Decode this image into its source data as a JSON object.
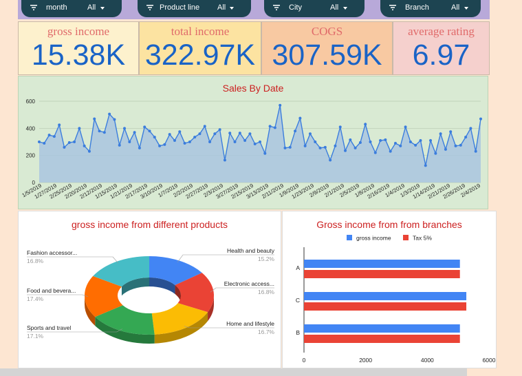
{
  "filters": [
    {
      "name": "month",
      "value": "All"
    },
    {
      "name": "Product line",
      "value": "All"
    },
    {
      "name": "City",
      "value": "All"
    },
    {
      "name": "Branch",
      "value": "All"
    }
  ],
  "kpis": [
    {
      "label": "gross income",
      "value": "15.38K"
    },
    {
      "label": "total income",
      "value": "322.97K"
    },
    {
      "label": "COGS",
      "value": "307.59K"
    },
    {
      "label": "average rating",
      "value": "6.97"
    }
  ],
  "colors": {
    "filter_bar": "#b8a9d9",
    "filter_pill": "#1d4451",
    "background": "#fde6d2",
    "kpi_bgs": [
      "#fdf1cd",
      "#fce3a1",
      "#f8c9a2",
      "#f5d0cd"
    ],
    "value_text": "#1a63c6",
    "title_text": "#cc1f1f",
    "line": "#3b7ddd",
    "area": "#a9c6df",
    "panel_green": "#d9ead3",
    "gross_bar": "#4285f4",
    "tax_bar": "#ea4335"
  },
  "sales_chart": {
    "title": "Sales By Date",
    "chart_data": {
      "type": "area",
      "title": "Sales By Date",
      "ylim": [
        0,
        600
      ],
      "y_ticks": [
        0,
        200,
        400,
        600
      ],
      "grid": true,
      "x_labels": [
        "1/5/2019",
        "1/27/2019",
        "2/25/2019",
        "2/20/2019",
        "2/12/2019",
        "1/15/2019",
        "1/21/2019",
        "2/17/2019",
        "3/10/2019",
        "1/7/2019",
        "2/2/2019",
        "2/27/2019",
        "2/3/2019",
        "3/27/2019",
        "2/15/2019",
        "3/13/2019",
        "2/11/2019",
        "1/9/2019",
        "1/23/2019",
        "2/9/2019",
        "2/1/2019",
        "2/5/2019",
        "1/8/2019",
        "2/16/2019",
        "1/4/2019",
        "1/3/2019",
        "1/14/2019",
        "2/21/2019",
        "2/26/2019",
        "2/4/2019"
      ],
      "values": [
        300,
        290,
        350,
        340,
        425,
        260,
        295,
        300,
        400,
        270,
        230,
        470,
        380,
        370,
        505,
        465,
        275,
        400,
        300,
        370,
        255,
        410,
        380,
        335,
        270,
        280,
        355,
        310,
        375,
        290,
        300,
        335,
        360,
        415,
        300,
        360,
        390,
        165,
        365,
        300,
        365,
        310,
        360,
        285,
        300,
        215,
        415,
        405,
        570,
        255,
        260,
        380,
        475,
        270,
        360,
        300,
        255,
        260,
        165,
        270,
        410,
        235,
        315,
        255,
        295,
        430,
        300,
        220,
        310,
        315,
        230,
        290,
        270,
        410,
        300,
        275,
        310,
        125,
        310,
        215,
        360,
        245,
        375,
        270,
        275,
        335,
        400,
        230,
        470
      ]
    }
  },
  "pie_chart": {
    "title": "gross income from different products",
    "chart_data": {
      "type": "pie",
      "slices": [
        {
          "label": "Health and beauty",
          "value": 15.2,
          "pct": "15.2%",
          "color": "#4285f4"
        },
        {
          "label": "Electronic access...",
          "value": 16.8,
          "pct": "16.8%",
          "color": "#ea4335"
        },
        {
          "label": "Home and lifestyle",
          "value": 16.7,
          "pct": "16.7%",
          "color": "#fbbc04"
        },
        {
          "label": "Sports and travel",
          "value": 17.1,
          "pct": "17.1%",
          "color": "#34a853"
        },
        {
          "label": "Food and bevera...",
          "value": 17.4,
          "pct": "17.4%",
          "color": "#ff6d01"
        },
        {
          "label": "Fashion accessor...",
          "value": 16.8,
          "pct": "16.8%",
          "color": "#46bdc6"
        }
      ]
    }
  },
  "bar_chart": {
    "title": "Gross income from from branches",
    "chart_data": {
      "type": "bar",
      "orientation": "horizontal",
      "categories": [
        "A",
        "C",
        "B"
      ],
      "series": [
        {
          "name": "gross income",
          "values": [
            5057,
            5265,
            5057
          ],
          "color": "#4285f4"
        },
        {
          "name": "Tax 5%",
          "values": [
            5057,
            5265,
            5057
          ],
          "color": "#ea4335"
        }
      ],
      "xlim": [
        0,
        6000
      ],
      "x_ticks": [
        0,
        2000,
        4000,
        6000
      ],
      "legend": "top"
    }
  }
}
